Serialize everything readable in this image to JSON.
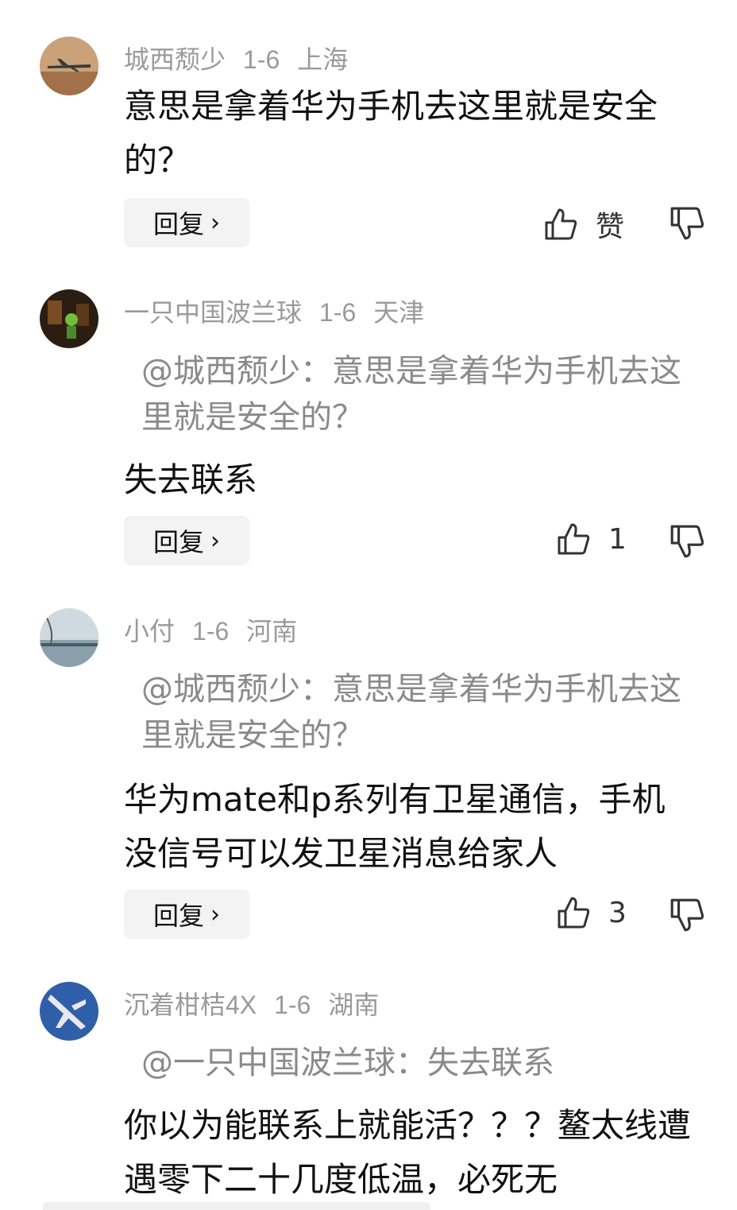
{
  "comments": [
    {
      "username": "城西颓少",
      "date": "1-6",
      "location": "上海",
      "quote": "",
      "text": "意思是拿着华为手机去这里就是安全的？",
      "reply_label": "回复",
      "like_label": "赞"
    },
    {
      "username": "一只中国波兰球",
      "date": "1-6",
      "location": "天津",
      "quote": "@城西颓少：意思是拿着华为手机去这里就是安全的？",
      "text": "失去联系",
      "reply_label": "回复",
      "like_label": "1"
    },
    {
      "username": "小付",
      "date": "1-6",
      "location": "河南",
      "quote": "@城西颓少：意思是拿着华为手机去这里就是安全的？",
      "text": "华为mate和p系列有卫星通信，手机没信号可以发卫星消息给家人",
      "reply_label": "回复",
      "like_label": "3"
    },
    {
      "username": "沉着柑桔4X",
      "date": "1-6",
      "location": "湖南",
      "quote": "@一只中国波兰球：失去联系",
      "text": "你以为能联系上就能活？？？鳌太线遭遇零下二十几度低温，必死无",
      "reply_label": "",
      "like_label": ""
    }
  ],
  "icons": {
    "like": "thumbs-up-icon",
    "dislike": "thumbs-down-icon",
    "chevron": "chevron-right-icon"
  },
  "colors": {
    "meta_gray": "#9a9a9a",
    "quote_gray": "#8a8a8a",
    "reply_bg": "#f3f3f3"
  }
}
